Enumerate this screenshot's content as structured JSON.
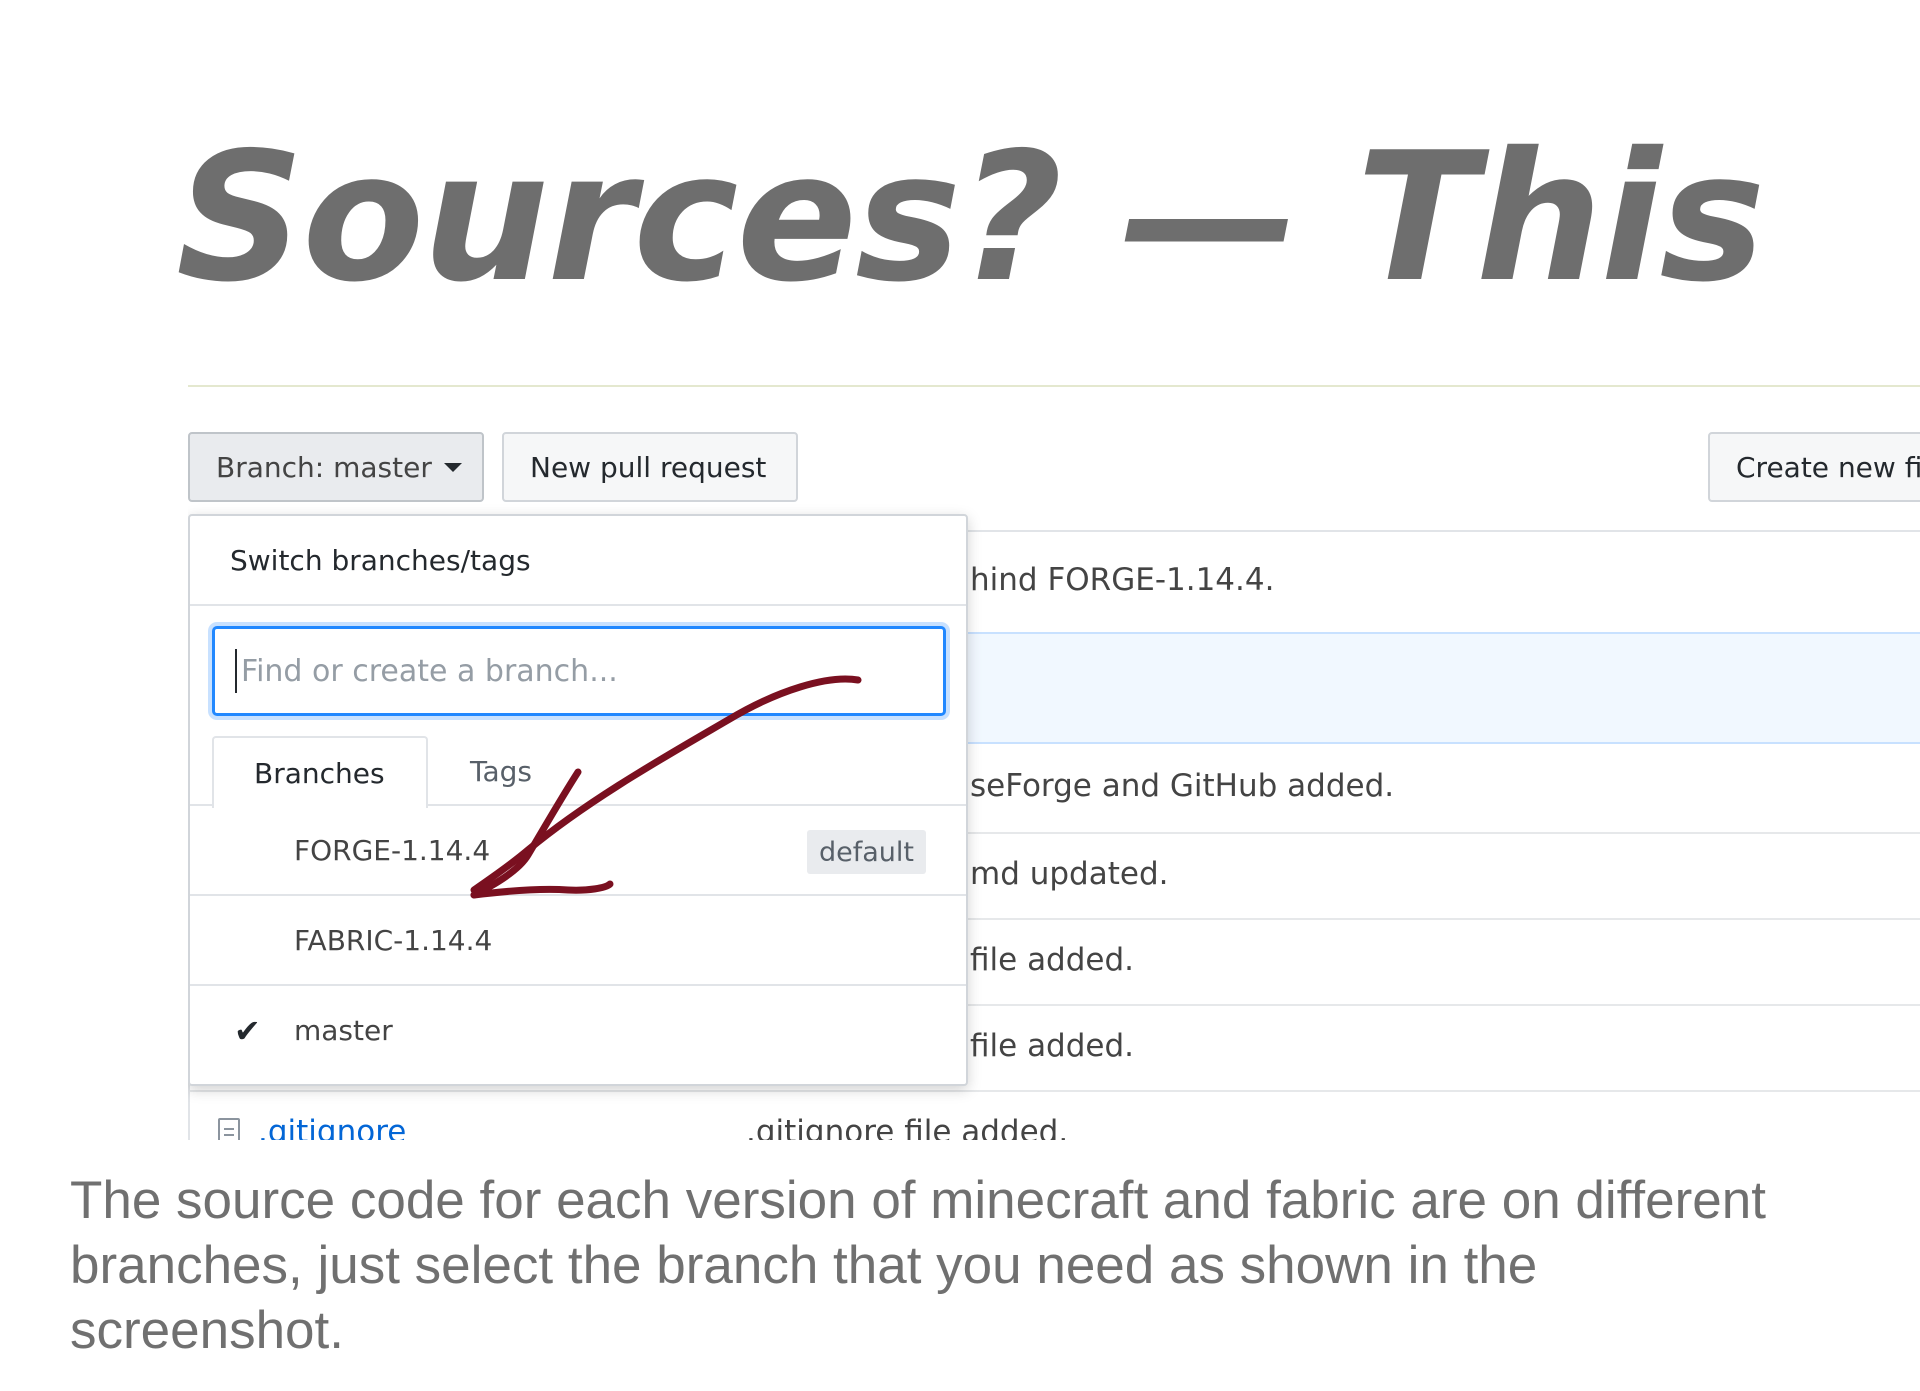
{
  "slide": {
    "title": "Sources? — This",
    "caption": "The source code for each version of minecraft and fabric are on different branches, just select the branch that you need as shown in the screenshot."
  },
  "toolbar": {
    "branch_button_label": "Branch: master",
    "new_pull_request_label": "New pull request",
    "create_new_file_label": "Create new fi"
  },
  "file_rows": [
    {
      "message": "hind FORGE-1.14.4."
    },
    {
      "message": ""
    },
    {
      "message": "seForge and GitHub added."
    },
    {
      "message": "md updated."
    },
    {
      "message": "file added."
    },
    {
      "message": "file added."
    },
    {
      "name": ".gitignore",
      "message": ".gitignore file added.",
      "icon": "file-icon"
    }
  ],
  "branch_dropdown": {
    "header": "Switch branches/tags",
    "search_placeholder": "Find or create a branch...",
    "tabs": [
      {
        "label": "Branches",
        "selected": true
      },
      {
        "label": "Tags",
        "selected": false
      }
    ],
    "branches": [
      {
        "name": "FORGE-1.14.4",
        "badge": "default",
        "checked": false
      },
      {
        "name": "FABRIC-1.14.4",
        "badge": "",
        "checked": false
      },
      {
        "name": "master",
        "badge": "",
        "checked": true,
        "check_icon": "checkmark-icon"
      }
    ]
  },
  "annotation": {
    "arrow_color": "#7a1020",
    "icon": "hand-drawn-arrow"
  },
  "colors": {
    "title": "#6e6e6e",
    "link": "#0366d6",
    "focus_ring": "#2188ff",
    "highlight_row": "#f1f8ff"
  }
}
